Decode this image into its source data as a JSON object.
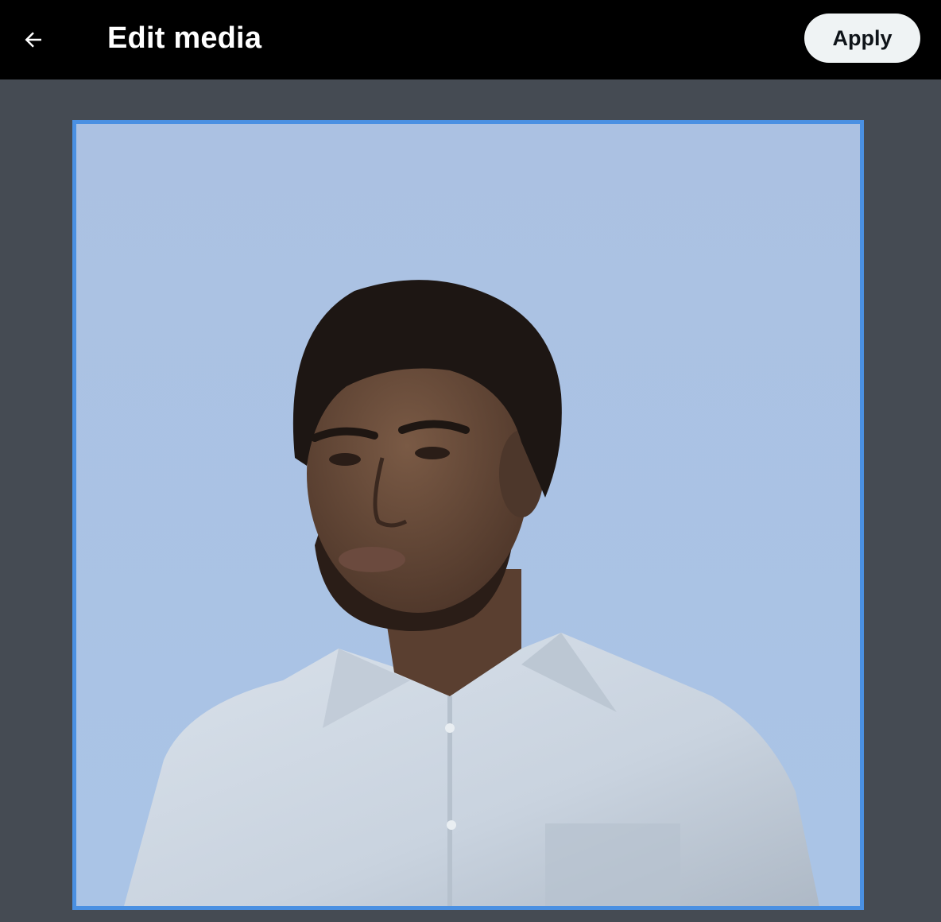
{
  "header": {
    "title": "Edit media",
    "apply_label": "Apply"
  },
  "icons": {
    "back": "arrow-left-icon"
  },
  "colors": {
    "header_bg": "#000000",
    "stage_bg": "#454b53",
    "crop_border": "#4a90e2",
    "sky": "#abc2e4",
    "apply_bg": "#eff3f4"
  }
}
